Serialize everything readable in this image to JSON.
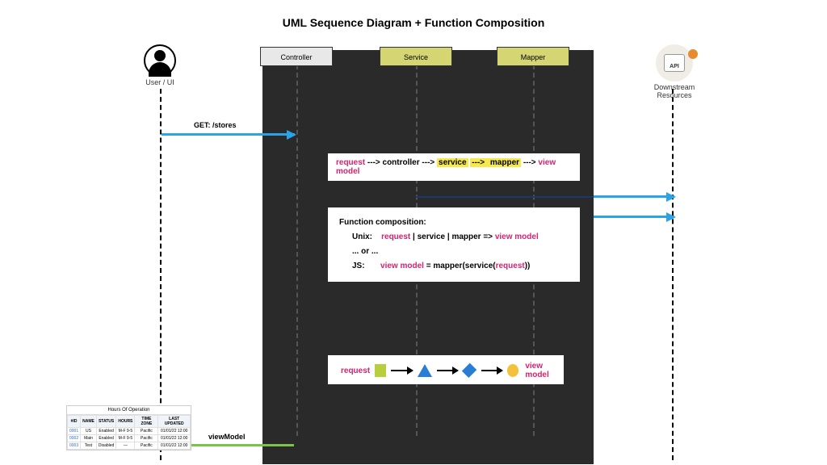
{
  "title": "UML Sequence Diagram + Function Composition",
  "actors": {
    "user_label": "User / UI",
    "downstream_label": "Downstream Resources",
    "api_text": "API"
  },
  "columns": {
    "controller": "Controller",
    "service": "Service",
    "mapper": "Mapper"
  },
  "arrows": {
    "get_label": "GET: /stores",
    "return_label": "viewModel"
  },
  "pipeline": {
    "request": "request",
    "controller": "controller",
    "service": "service",
    "mapper": "mapper",
    "viewmodel": "view model",
    "sep": " ---> "
  },
  "composition": {
    "title": "Function composition:",
    "unix_label": "Unix:",
    "unix_req": "request",
    "unix_mid": " | service | mapper => ",
    "unix_vm": "view model",
    "or": "... or ...",
    "js_label": "JS:",
    "js_vm": "view model",
    "js_mid": " = mapper(service(",
    "js_req": "request",
    "js_end": "))"
  },
  "shape_row": {
    "request": "request",
    "viewmodel": "view model"
  },
  "table": {
    "title": "Hours Of Operation",
    "headers": [
      "#ID",
      "NAME",
      "STATUS",
      "HOURS",
      "TIME ZONE",
      "LAST UPDATED"
    ],
    "rows": [
      [
        "0001",
        "US",
        "Enabled",
        "M-F 9-5",
        "Pacific",
        "01/01/22 12:00"
      ],
      [
        "0002",
        "Main",
        "Enabled",
        "M-F 9-5",
        "Pacific",
        "01/01/22 12:00"
      ],
      [
        "0003",
        "Test",
        "Disabled",
        "—",
        "Pacific",
        "01/01/22 12:00"
      ]
    ]
  }
}
